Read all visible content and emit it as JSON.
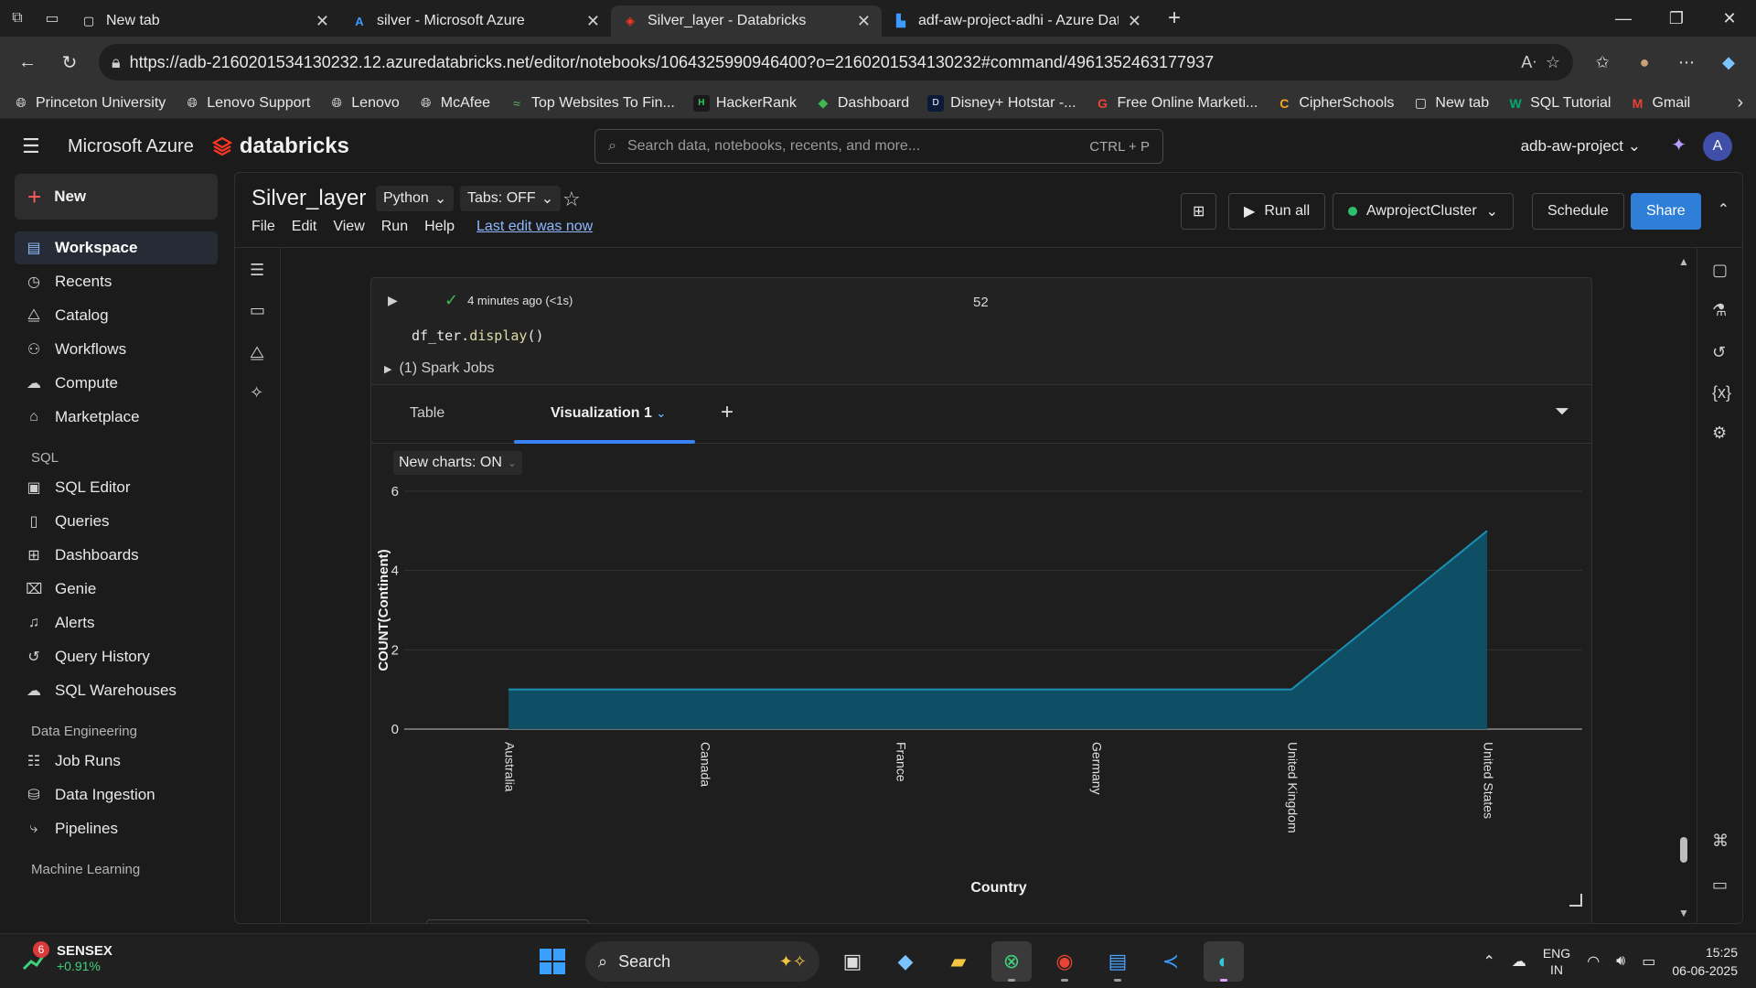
{
  "browser": {
    "tabs": [
      {
        "title": "New tab",
        "icon": "newtab-icon"
      },
      {
        "title": "silver - Microsoft Azure",
        "icon": "azure-icon"
      },
      {
        "title": "Silver_layer - Databricks",
        "icon": "databricks-icon"
      },
      {
        "title": "adf-aw-project-adhi - Azure Data",
        "icon": "adf-icon"
      }
    ],
    "active_tab": 2,
    "url": "https://adb-2160201534130232.12.azuredatabricks.net/editor/notebooks/1064325990946400?o=2160201534130232#command/4961352463177937",
    "bookmarks": [
      "Princeton University",
      "Lenovo Support",
      "Lenovo",
      "McAfee",
      "Top Websites To Fin...",
      "HackerRank",
      "Dashboard",
      "Disney+ Hotstar -...",
      "Free Online Marketi...",
      "CipherSchools",
      "New tab",
      "SQL Tutorial",
      "Gmail"
    ]
  },
  "app": {
    "brand": "Microsoft Azure",
    "product": "databricks",
    "search_placeholder": "Search data, notebooks, recents, and more...",
    "search_shortcut": "CTRL + P",
    "workspace": "adb-aw-project",
    "avatar": "A"
  },
  "sidebar": {
    "new_label": "New",
    "main": [
      {
        "label": "Workspace",
        "icon": "workspace-icon",
        "active": true
      },
      {
        "label": "Recents",
        "icon": "clock-icon"
      },
      {
        "label": "Catalog",
        "icon": "catalog-icon"
      },
      {
        "label": "Workflows",
        "icon": "workflows-icon"
      },
      {
        "label": "Compute",
        "icon": "cloud-icon"
      },
      {
        "label": "Marketplace",
        "icon": "store-icon"
      }
    ],
    "sql_title": "SQL",
    "sql": [
      "SQL Editor",
      "Queries",
      "Dashboards",
      "Genie",
      "Alerts",
      "Query History",
      "SQL Warehouses"
    ],
    "de_title": "Data Engineering",
    "de": [
      "Job Runs",
      "Data Ingestion",
      "Pipelines"
    ],
    "ml_title": "Machine Learning"
  },
  "notebook": {
    "title": "Silver_layer",
    "language": "Python",
    "tabs_mode": "Tabs: OFF",
    "menu": [
      "File",
      "Edit",
      "View",
      "Run",
      "Help"
    ],
    "last_edit": "Last edit was now",
    "run_all": "Run all",
    "cluster": "AwprojectCluster",
    "schedule": "Schedule",
    "share": "Share"
  },
  "cell": {
    "status": "4 minutes ago (<1s)",
    "number": "52",
    "code_obj": "df_ter.",
    "code_fn": "display",
    "code_tail": "()",
    "spark_jobs": "(1) Spark Jobs",
    "result_tabs": [
      "Table",
      "Visualization 1"
    ],
    "new_charts": "New charts: ON"
  },
  "chart_data": {
    "type": "area",
    "categories": [
      "Australia",
      "Canada",
      "France",
      "Germany",
      "United Kingdom",
      "United States"
    ],
    "values": [
      1,
      1,
      1,
      1,
      1,
      5
    ],
    "xlabel": "Country",
    "ylabel": "COUNT(Continent)",
    "ylim": [
      0,
      6
    ],
    "yticks": [
      0,
      2,
      4,
      6
    ],
    "grid": true,
    "fill_color": "#0f4f66",
    "line_color": "#1b8fb3"
  },
  "taskbar": {
    "ticker_name": "SENSEX",
    "ticker_change": "+0.91%",
    "ticker_badge": "6",
    "search": "Search",
    "lang": "ENG",
    "region": "IN",
    "time": "15:25",
    "date": "06-06-2025"
  }
}
